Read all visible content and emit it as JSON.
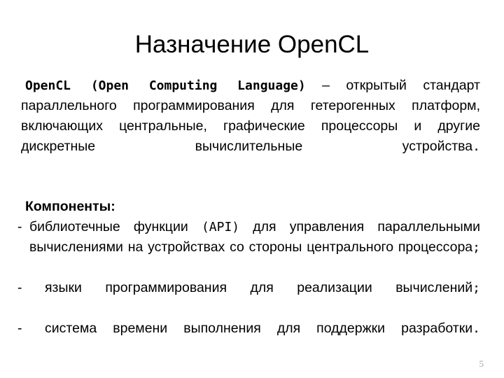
{
  "slide": {
    "title": "Назначение OpenCL",
    "page_number": "5",
    "text_color": "#000000",
    "page_number_color": "#a6a6a6",
    "background_color": "#ffffff"
  },
  "intro": {
    "term_bold": "OpenCL (Open Computing Language)",
    "dash": " – ",
    "rest": "открытый стандарт параллельного программирования для гетерогенных платформ, включающих центральные, графические процессоры и другие дискретные вычислительные устройства",
    "period": "."
  },
  "components": {
    "heading": "Компоненты:",
    "items": [
      {
        "dash": "-",
        "lead": "библиотечные функции ",
        "mono": "(API)",
        "tail": " для управления параллельными вычислениями на устройствах со стороны центрального процессора",
        "terminator": ";"
      },
      {
        "dash": "-",
        "lead": "",
        "mono": "",
        "tail": "языки программирования для реализации вычислений",
        "terminator": ";"
      },
      {
        "dash": "-",
        "lead": "",
        "mono": "",
        "tail": "система времени выполнения для поддержки разработки",
        "terminator": "."
      }
    ]
  }
}
